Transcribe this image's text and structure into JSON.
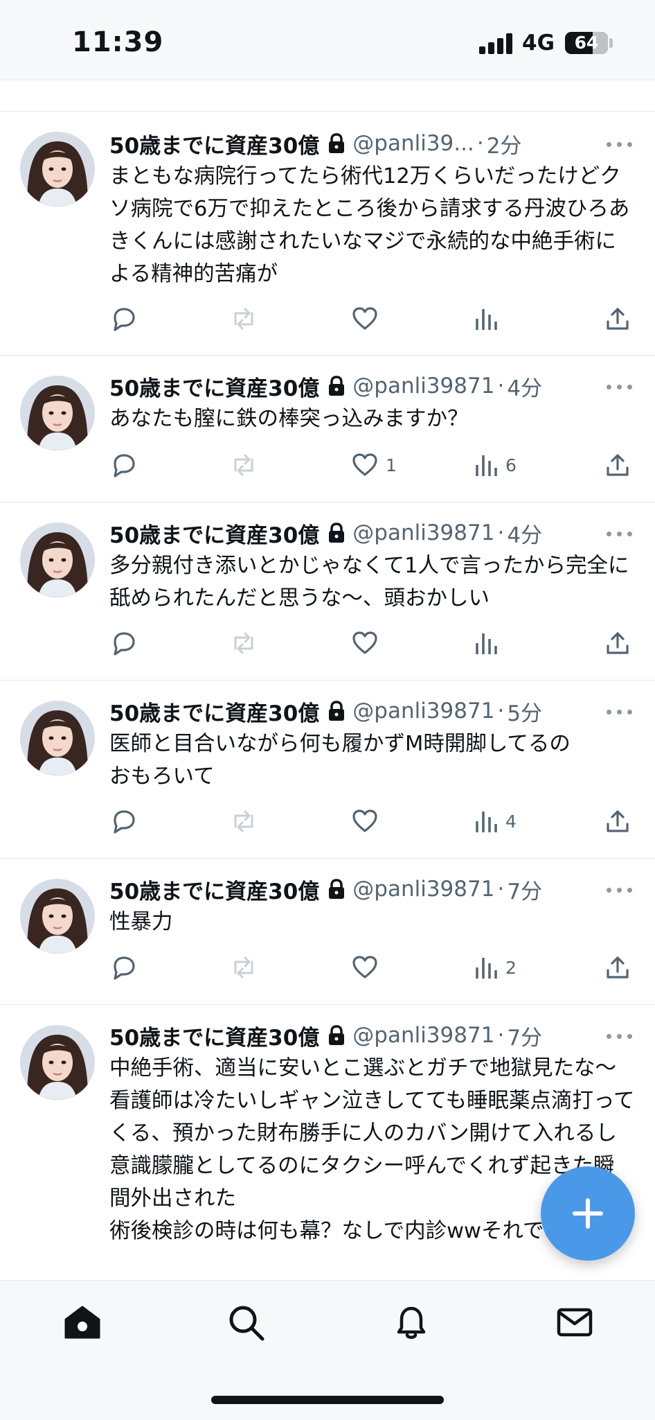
{
  "status_bar": {
    "time": "11:39",
    "network": "4G",
    "battery": "64"
  },
  "tweets": [
    {
      "name": "50歳までに資産30億",
      "handle": "@panli39...",
      "time": "2分",
      "text": "まともな病院行ってたら術代12万くらいだったけどクソ病院で6万で抑えたところ後から請求する丹波ひろあきくんには感謝されたいなマジで永続的な中絶手術による精神的苦痛が",
      "likes": "",
      "views": ""
    },
    {
      "name": "50歳までに資産30億",
      "handle": "@panli39871",
      "time": "4分",
      "text": "あなたも膣に鉄の棒突っ込みますか？",
      "likes": "1",
      "views": "6"
    },
    {
      "name": "50歳までに資産30億",
      "handle": "@panli39871",
      "time": "4分",
      "text": "多分親付き添いとかじゃなくて1人で言ったから完全に舐められたんだと思うな〜、頭おかしい",
      "likes": "",
      "views": ""
    },
    {
      "name": "50歳までに資産30億",
      "handle": "@panli39871",
      "time": "5分",
      "text": "医師と目合いながら何も履かずM時開脚してるの\nおもろいて",
      "likes": "",
      "views": "4"
    },
    {
      "name": "50歳までに資産30億",
      "handle": "@panli39871",
      "time": "7分",
      "text": "性暴力",
      "likes": "",
      "views": "2"
    },
    {
      "name": "50歳までに資産30億",
      "handle": "@panli39871",
      "time": "7分",
      "text": "中絶手術、適当に安いとこ選ぶとガチで地獄見たな〜\n看護師は冷たいしギャン泣きしてても睡眠薬点滴打ってくる、預かった財布勝手に人のカバン開けて入れるし意識朦朧としてるのにタクシー呼んでくれず起きた瞬間外出された\n術後検診の時は何も幕？なしで内診wwそれでお",
      "likes": "",
      "views": ""
    }
  ],
  "icons": {
    "lock": "lock-icon",
    "reply": "reply-icon",
    "retweet": "retweet-icon",
    "like": "heart-icon",
    "views": "views-icon",
    "share": "share-icon",
    "compose": "plus-icon",
    "nav": [
      "home-icon",
      "search-icon",
      "bell-icon",
      "mail-icon"
    ]
  },
  "colors": {
    "accent": "#4a99e9",
    "secondary_text": "#536471",
    "primary_text": "#0f1419"
  }
}
